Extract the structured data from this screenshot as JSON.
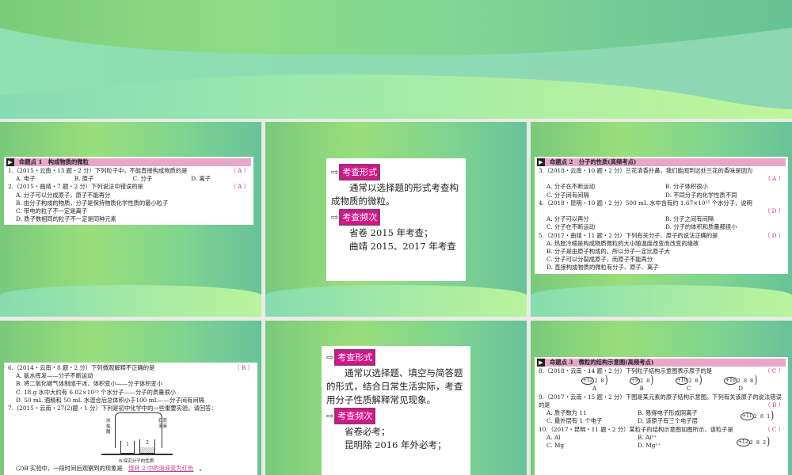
{
  "slides": [
    {
      "section": "命题点 1　构成物质的微粒",
      "questions": [
        {
          "stem": "1.（2015・云南・13 题・2 分）下列粒子中，不能直接构成物质的是",
          "answer": "（ A ）",
          "options": [
            "A. 电子",
            "B. 原子",
            "C. 分子",
            "D. 离子"
          ]
        },
        {
          "stem": "2.（2015・曲靖・7 题・2 分）下列说法中错误的是",
          "answer": "（ A ）",
          "options": [
            "A. 分子可以分成原子，原子不能再分",
            "B. 由分子构成的物质，分子是保持物质化学性质的最小粒子",
            "C. 带电的粒子不一定是离子",
            "D. 质子数相同的粒子不一定是同种元素"
          ]
        }
      ]
    },
    {
      "form_label": "考查形式",
      "form_text": "通常以选择题的形式考查构成物质的微粒。",
      "freq_label": "考查频次",
      "freq_lines": [
        "省卷 2015 年考查；",
        "曲靖 2015、2017 年考查"
      ]
    },
    {
      "section": "命题点 2　分子的性质(高频考点)",
      "questions": [
        {
          "stem": "3.（2018・云南・10 题・2 分）兰花清香扑鼻，我们能闻到远处兰花的香味是因为",
          "answer": "（ A ）",
          "options": [
            "A. 分子在不断运动",
            "B. 分子体积很小",
            "C. 分子间有间隔",
            "D. 不同分子的化学性质不同"
          ]
        },
        {
          "stem": "4.（2018・昆明・10 题・2 分）500 mL 水中含有约 1.67×10²⁵ 个水分子，说明",
          "answer": "（ D ）",
          "options": [
            "A. 分子可以再分",
            "B. 分子之间有间隔",
            "C. 分子在不断运动",
            "D. 分子的体积和质量都很小"
          ]
        },
        {
          "stem": "5.（2017・曲靖・11 题・2 分）下列有关分子、原子的说法正确的是",
          "answer": "（ D ）",
          "options": [
            "A. 热胀冷缩是构成物质微粒的大小随温度改变而改变的缘故",
            "B. 分子是由原子构成的，所以分子一定比原子大",
            "C. 分子可以分裂成原子，而原子不能再分",
            "D. 直接构成物质的微粒有分子、原子、离子"
          ]
        }
      ]
    },
    {
      "questions": [
        {
          "stem": "6.（2014・云南・8 题・2 分）下列微观解释不正确的是",
          "answer": "（ B ）",
          "options": [
            "A. 氨水挥发——分子不断运动",
            "B. 将二氧化碳气体制成干冰，体积变小——分子体积变小",
            "C. 18 g 水中大约有 6.02×10²³ 个水分子——分子的质量很小",
            "D. 50 mL 酒精和 50 mL 水混合后总体积小于100 mL——分子间有间隔"
          ]
        },
        {
          "stem": "7.（2015・云南・27(2)题・1 分）下列是初中化学中的一些重要实验。请回答：",
          "answer": "",
          "options": []
        }
      ],
      "figure": {
        "left_label": "浓盐酸",
        "right_label": "石蕊溶液",
        "beaker1": "1",
        "beaker2": "2",
        "caption": "B.探究分子的性质"
      },
      "fill": {
        "prefix": "(2)B 实验中，一段时间后观察到的现象是",
        "answer": "烧杯 2 中的溶液变为红色",
        "suffix": "。"
      }
    },
    {
      "form_label": "考查形式",
      "form_text": "通常以选择题、填空与简答题的形式，结合日常生活实际，考查用分子性质解释常见现象。",
      "freq_label": "考查频次",
      "freq_lines": [
        "省卷必考；",
        "昆明除 2016 年外必考；"
      ]
    },
    {
      "section": "命题点 3　微粒的结构示意图(高频考点)",
      "q8": {
        "stem": "8.（2018・云南・14 题・2 分）下列粒子结构示意图表示原子的是",
        "answer": "（ C ）",
        "atoms": [
          {
            "nucleus": "+12",
            "shells": "2 8",
            "label": "A"
          },
          {
            "nucleus": "+9",
            "shells": "2 8",
            "label": "B"
          },
          {
            "nucleus": "+10",
            "shells": "2 8",
            "label": "C"
          },
          {
            "nucleus": "+16",
            "shells": "2 8 8",
            "label": "D"
          }
        ]
      },
      "q9": {
        "stem": "9.（2017・云南・15 题・2 分）下图是某元素的原子结构示意图。下列有关该原子的说法错误的是",
        "answer": "（ B ）",
        "options": [
          "A. 质子数为 11",
          "B. 易得电子形成阴离子",
          "C. 最外层有 1 个电子",
          "D. 该原子有三个电子层"
        ],
        "atom": {
          "nucleus": "+11",
          "shells": "2 8 1"
        }
      },
      "q10": {
        "stem": "10.（2017・昆明・11 题・2 分）某粒子的结构示意图如图所示，该粒子是",
        "answer": "（ C ）",
        "options": [
          "A. Al",
          "B. Al³⁺",
          "C. Mg",
          "D. Mg²⁺"
        ],
        "atom": {
          "nucleus": "+12",
          "shells": "2 8 2"
        }
      }
    }
  ],
  "colors": {
    "accent": "#d6168a",
    "section_bg": "#e8a6c8",
    "answer": "#c2378f"
  }
}
